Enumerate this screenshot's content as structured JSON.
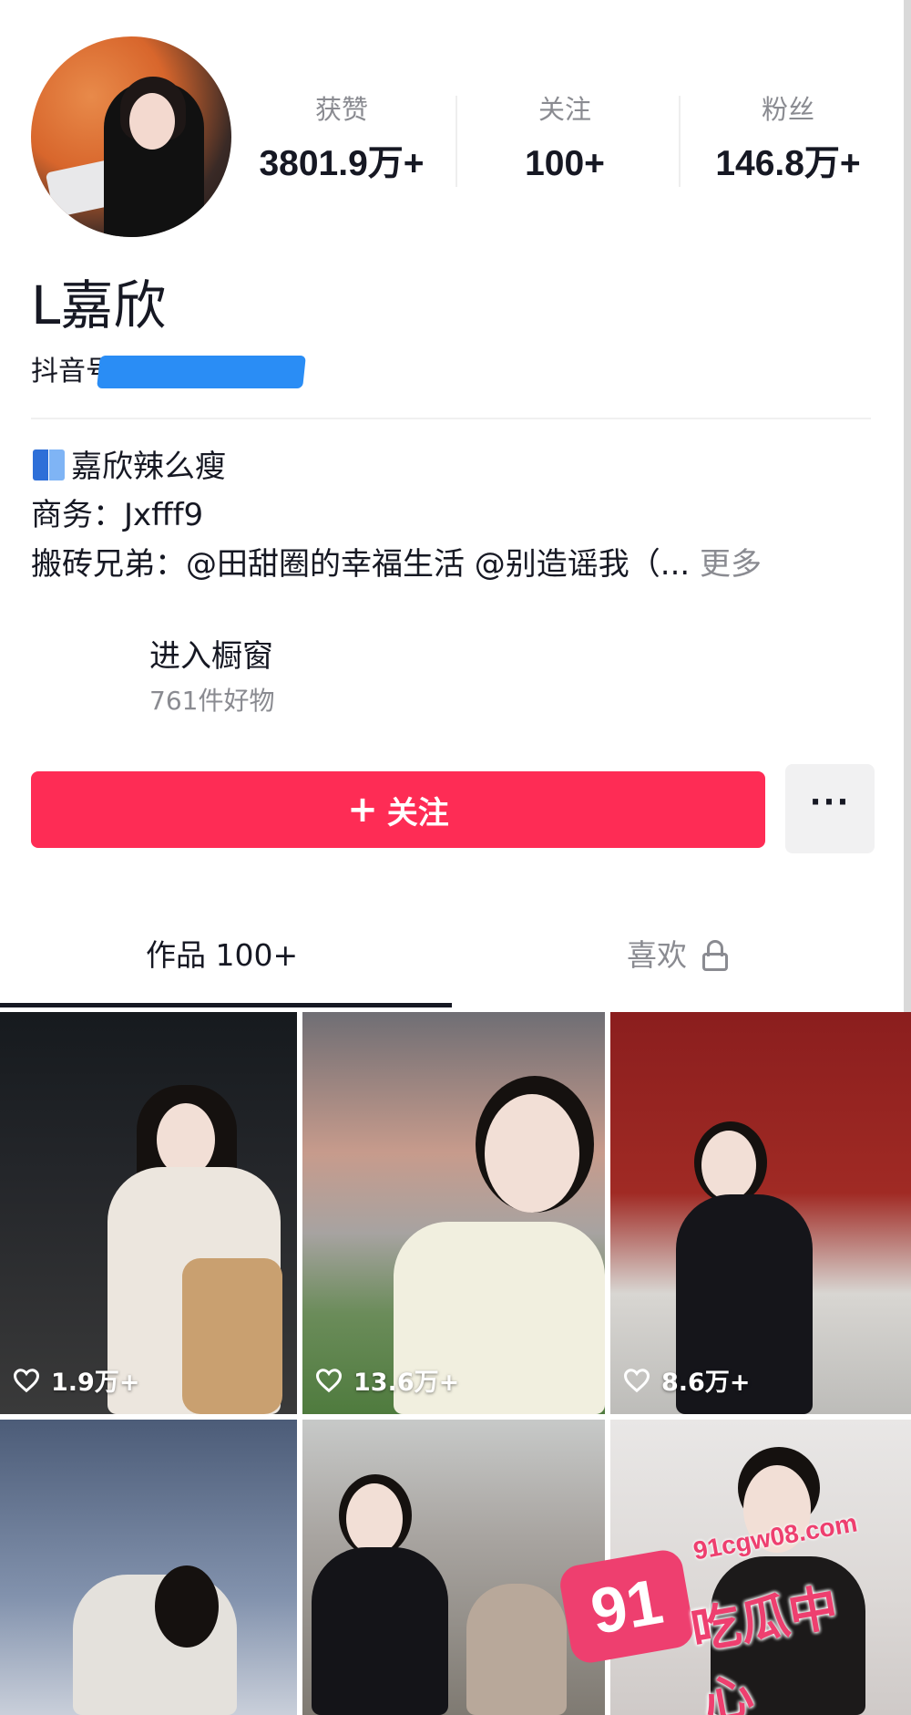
{
  "profile": {
    "username": "L嘉欣",
    "douyin_id_label": "抖音号",
    "stats": [
      {
        "label": "获赞",
        "value": "3801.9万+"
      },
      {
        "label": "关注",
        "value": "100+"
      },
      {
        "label": "粉丝",
        "value": "146.8万+"
      }
    ]
  },
  "bio": {
    "line1": "嘉欣辣么瘦",
    "line2": "商务：Jxfff9",
    "line3": "搬砖兄弟：@田甜圈的幸福生活 @别造谣我（...",
    "more": "更多"
  },
  "shop": {
    "title": "进入橱窗",
    "subtitle": "761件好物"
  },
  "actions": {
    "follow_plus": "+",
    "follow_label": "关注",
    "more_dots": "···"
  },
  "tabs": {
    "works": "作品 100+",
    "likes": "喜欢"
  },
  "videos": [
    {
      "likes": "1.9万+"
    },
    {
      "likes": "13.6万+"
    },
    {
      "likes": "8.6万+"
    }
  ],
  "watermark": {
    "number": "91",
    "url": "91cgw08.com",
    "name": "吃瓜中心"
  },
  "colors": {
    "follow": "#fe2c55",
    "watermark": "#ee3f6f"
  }
}
